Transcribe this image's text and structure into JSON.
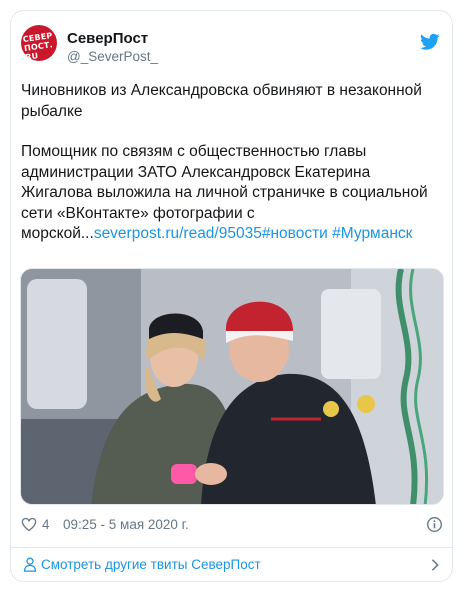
{
  "account": {
    "display_name": "СеверПост",
    "handle": "@_SeverPost_",
    "avatar_logo_text": "СЕВЕР ПОСТ. RU"
  },
  "tweet": {
    "headline": "Чиновников из Александровска обвиняют в незаконной рыбалке",
    "body_line1": "Помощник по связям с общественностью главы администрации ЗАТО Александровск Екатерина Жигалова выложила на личной страничке в социальной сети «ВКонтакте» фотографии с морской...",
    "link": "severpost.ru/read/95035",
    "hashtag1": "#новости",
    "hashtag2": "#Мурманск"
  },
  "meta": {
    "likes": "4",
    "timestamp": "09:25 - 5 мая 2020 г."
  },
  "footer": {
    "more_tweets_label": "Смотреть другие твиты СеверПост"
  },
  "colors": {
    "link": "#1b95e0",
    "brand_red": "#c9182b",
    "muted": "#657786",
    "twitter_blue": "#1da1f2"
  },
  "icons": [
    "twitter-bird-icon",
    "heart-icon",
    "info-icon",
    "person-icon",
    "chevron-right-icon"
  ]
}
